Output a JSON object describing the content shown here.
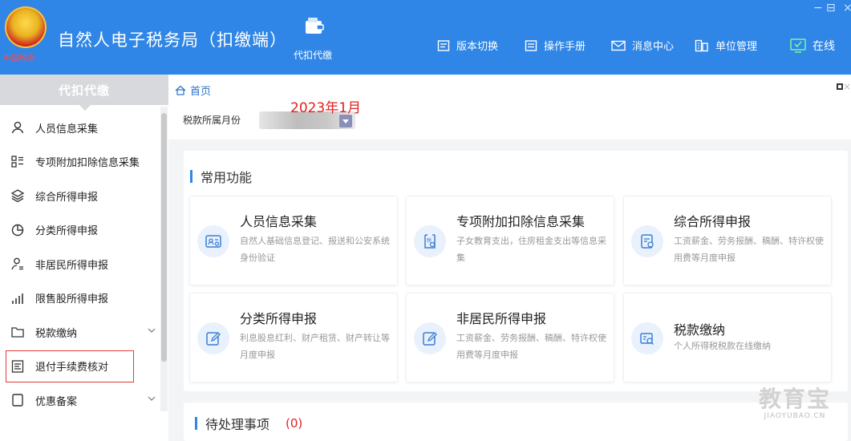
{
  "header": {
    "emblem_text": "中国税务",
    "app_title": "自然人电子税务局（扣缴端）",
    "daikou_label": "代扣代缴",
    "nav": [
      {
        "label": "版本切换",
        "icon": "switch-icon"
      },
      {
        "label": "操作手册",
        "icon": "manual-icon"
      },
      {
        "label": "消息中心",
        "icon": "message-icon"
      },
      {
        "label": "单位管理",
        "icon": "company-icon"
      },
      {
        "label": "在线",
        "icon": "online-check-icon"
      }
    ],
    "window_controls": {
      "minimize": "−",
      "restore": "⊟",
      "close": "×"
    }
  },
  "sidebar": {
    "title": "代扣代缴",
    "items": [
      {
        "label": "人员信息采集",
        "icon": "person-icon"
      },
      {
        "label": "专项附加扣除信息采集",
        "icon": "list-icon"
      },
      {
        "label": "综合所得申报",
        "icon": "layers-icon"
      },
      {
        "label": "分类所得申报",
        "icon": "pie-icon"
      },
      {
        "label": "非居民所得申报",
        "icon": "person-outline-icon"
      },
      {
        "label": "限售股所得申报",
        "icon": "bar-chart-icon"
      },
      {
        "label": "税款缴纳",
        "icon": "folder-icon",
        "expandable": true
      },
      {
        "label": "退付手续费核对",
        "icon": "receipt-icon",
        "highlighted": true
      },
      {
        "label": "优惠备案",
        "icon": "document-icon",
        "expandable": true
      }
    ]
  },
  "tabbar": {
    "home_tab": "首页",
    "close": "×"
  },
  "period": {
    "label": "税款所属月份",
    "annotation": "2023年1月"
  },
  "common_functions": {
    "title": "常用功能",
    "items": [
      {
        "title": "人员信息采集",
        "desc": "自然人基础信息登记、报送和公安系统身份验证",
        "icon": "person-card-icon"
      },
      {
        "title": "专项附加扣除信息采集",
        "desc": "子女教育支出，住房租金支出等信息采集",
        "icon": "tax-form-icon"
      },
      {
        "title": "综合所得申报",
        "desc": "工资薪金、劳务报酬、稿酬、特许权使用费等月度申报",
        "icon": "report-icon"
      },
      {
        "title": "分类所得申报",
        "desc": "利息股息红利、财产租赁、财产转让等月度申报",
        "icon": "edit-icon"
      },
      {
        "title": "非居民所得申报",
        "desc": "工资薪金、劳务报酬、稿酬、特许权使用费等月度申报",
        "icon": "edit-icon"
      },
      {
        "title": "税款缴纳",
        "desc": "个人所得税税款在线缴纳",
        "icon": "payment-icon"
      }
    ]
  },
  "pending": {
    "title": "待处理事项",
    "count": "(0)"
  },
  "watermark": {
    "big": "教育宝",
    "small": "JIAOYUBAO.CN"
  }
}
